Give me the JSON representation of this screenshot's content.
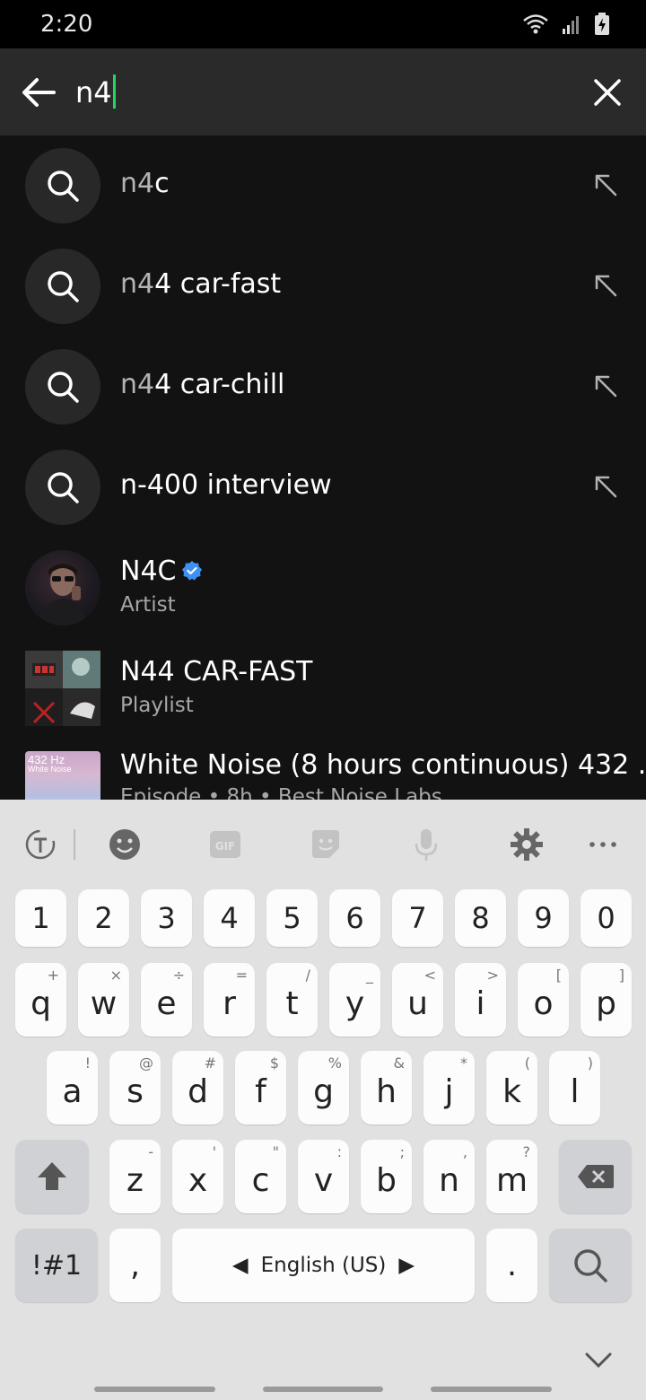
{
  "status": {
    "time": "2:20"
  },
  "search": {
    "query": "n4"
  },
  "suggestions": [
    {
      "prefix": "n4",
      "rest": "c"
    },
    {
      "prefix": "n4",
      "rest": "4 car-fast"
    },
    {
      "prefix": "n4",
      "rest": "4 car-chill"
    },
    {
      "prefix": "n-",
      "rest": "400 interview"
    }
  ],
  "items": [
    {
      "title": "N4C",
      "subtitle": "Artist",
      "verified": true
    },
    {
      "title": "N44 CAR-FAST",
      "subtitle": "Playlist"
    },
    {
      "title": "White Noise (8 hours continuous) 432 ...",
      "subtitle": "Episode • 8h • Best Noise Labs",
      "thumb_text": "432 Hz",
      "thumb_sub": "White Noise"
    }
  ],
  "keyboard": {
    "numbers": [
      "1",
      "2",
      "3",
      "4",
      "5",
      "6",
      "7",
      "8",
      "9",
      "0"
    ],
    "row1": [
      {
        "k": "q",
        "s": "+"
      },
      {
        "k": "w",
        "s": "×"
      },
      {
        "k": "e",
        "s": "÷"
      },
      {
        "k": "r",
        "s": "="
      },
      {
        "k": "t",
        "s": "/"
      },
      {
        "k": "y",
        "s": "_"
      },
      {
        "k": "u",
        "s": "<"
      },
      {
        "k": "i",
        "s": ">"
      },
      {
        "k": "o",
        "s": "["
      },
      {
        "k": "p",
        "s": "]"
      }
    ],
    "row2": [
      {
        "k": "a",
        "s": "!"
      },
      {
        "k": "s",
        "s": "@"
      },
      {
        "k": "d",
        "s": "#"
      },
      {
        "k": "f",
        "s": "$"
      },
      {
        "k": "g",
        "s": "%"
      },
      {
        "k": "h",
        "s": "&"
      },
      {
        "k": "j",
        "s": "*"
      },
      {
        "k": "k",
        "s": "("
      },
      {
        "k": "l",
        "s": ")"
      }
    ],
    "row3": [
      {
        "k": "z",
        "s": "-"
      },
      {
        "k": "x",
        "s": "'"
      },
      {
        "k": "c",
        "s": "\""
      },
      {
        "k": "v",
        "s": ":"
      },
      {
        "k": "b",
        "s": ";"
      },
      {
        "k": "n",
        "s": ","
      },
      {
        "k": "m",
        "s": "?"
      }
    ],
    "symbols_label": "!#1",
    "comma": ",",
    "space_label": "English (US)",
    "period": "."
  },
  "colors": {
    "accent": "#1ed760",
    "verified": "#3d91f4",
    "background": "#121212"
  }
}
